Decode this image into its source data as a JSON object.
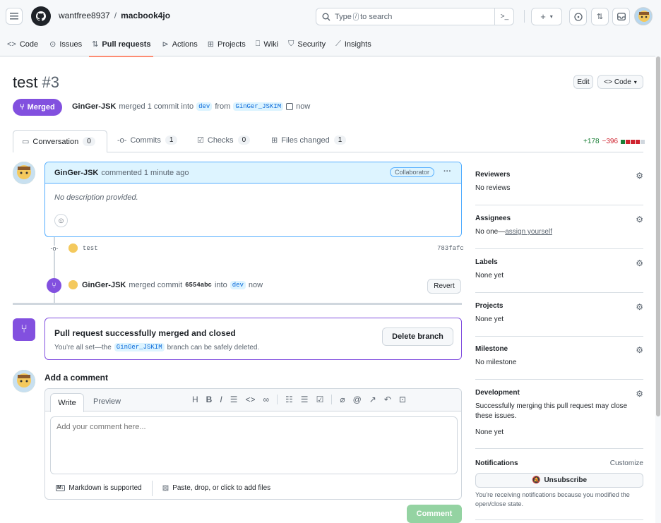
{
  "header": {
    "owner": "wantfree8937",
    "separator": "/",
    "repo": "macbook4jo",
    "search_placeholder_prefix": "Type",
    "search_key": "/",
    "search_placeholder_suffix": "to search"
  },
  "nav": {
    "code": "Code",
    "issues": "Issues",
    "pull_requests": "Pull requests",
    "actions": "Actions",
    "projects": "Projects",
    "wiki": "Wiki",
    "security": "Security",
    "insights": "Insights"
  },
  "pr": {
    "title": "test",
    "number": "#3",
    "status": "Merged",
    "author": "GinGer-JSK",
    "merge_text": "merged 1 commit into",
    "base": "dev",
    "from": "from",
    "head": "GinGer_JSKIM",
    "time": "now",
    "edit": "Edit",
    "code_btn": "Code"
  },
  "tabs": {
    "conversation": "Conversation",
    "conversation_count": "0",
    "commits": "Commits",
    "commits_count": "1",
    "checks": "Checks",
    "checks_count": "0",
    "files": "Files changed",
    "files_count": "1",
    "additions": "+178",
    "deletions": "−396"
  },
  "comment": {
    "author": "GinGer-JSK",
    "time_text": "commented 1 minute ago",
    "badge": "Collaborator",
    "body": "No description provided."
  },
  "timeline": {
    "commit_msg": "test",
    "commit_sha": "783fafc",
    "merge_author": "GinGer-JSK",
    "merge_text": "merged commit",
    "merge_sha": "6554abc",
    "into": "into",
    "base": "dev",
    "time": "now",
    "revert": "Revert"
  },
  "merged_box": {
    "title": "Pull request successfully merged and closed",
    "text_prefix": "You’re all set—the",
    "branch": "GinGer_JSKIM",
    "text_suffix": "branch can be safely deleted.",
    "delete_btn": "Delete branch"
  },
  "add_comment": {
    "heading": "Add a comment",
    "write": "Write",
    "preview": "Preview",
    "placeholder": "Add your comment here...",
    "markdown": "Markdown is supported",
    "paste": "Paste, drop, or click to add files",
    "submit": "Comment"
  },
  "sidebar": {
    "reviewers": {
      "title": "Reviewers",
      "value": "No reviews"
    },
    "assignees": {
      "title": "Assignees",
      "value_prefix": "No one—",
      "value_link": "assign yourself"
    },
    "labels": {
      "title": "Labels",
      "value": "None yet"
    },
    "projects": {
      "title": "Projects",
      "value": "None yet"
    },
    "milestone": {
      "title": "Milestone",
      "value": "No milestone"
    },
    "development": {
      "title": "Development",
      "text": "Successfully merging this pull request may close these issues.",
      "value": "None yet"
    },
    "notifications": {
      "title": "Notifications",
      "customize": "Customize",
      "unsubscribe": "Unsubscribe",
      "note": "You’re receiving notifications because you modified the open/close state."
    }
  },
  "colors": {
    "merged": "#8250df",
    "accent": "#fd8c73",
    "link": "#0969da",
    "add": "#1a7f37",
    "del": "#cf222e"
  }
}
